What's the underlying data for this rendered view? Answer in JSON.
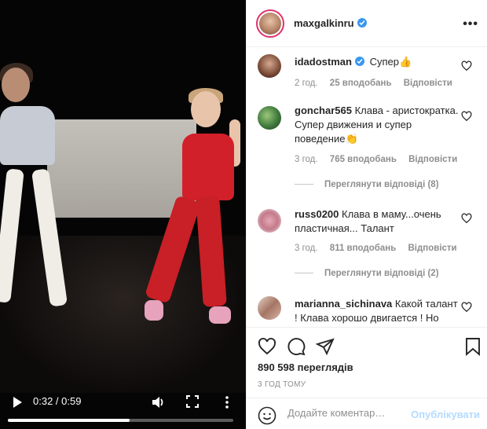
{
  "post": {
    "username": "maxgalkinru",
    "views_label": "890 598 переглядів",
    "time_ago": "3 ГОД ТОМУ"
  },
  "video": {
    "current_time": "0:32",
    "duration": "0:59",
    "time_separator": " / ",
    "progress_fraction": 0.54
  },
  "comments": [
    {
      "username": "idadostman",
      "verified": true,
      "text": "Супер👍",
      "time": "2 год.",
      "likes": "25 вподобань",
      "reply": "Відповісти"
    },
    {
      "username": "gonchar565",
      "verified": false,
      "text": "Клава - аристократка. Супер движения и супер поведение👏",
      "time": "3 год.",
      "likes": "765 вподобань",
      "reply": "Відповісти",
      "view_replies": "Переглянути відповіді (8)"
    },
    {
      "username": "russ0200",
      "verified": false,
      "text": "Клава в маму...очень пластичная... Талант",
      "time": "3 год.",
      "likes": "811 вподобань",
      "reply": "Відповісти",
      "view_replies": "Переглянути відповіді (2)"
    },
    {
      "username": "marianna_sichinava",
      "verified": false,
      "text": "Какой талант ! Клава хорошо двигается ! Но"
    }
  ],
  "add_comment": {
    "placeholder": "Додайте коментар…",
    "publish_label": "Опублікувати"
  },
  "colors": {
    "verified": "#3897f0",
    "publish_disabled": "#b3dbff",
    "avatar_ring": "#e1306c"
  }
}
